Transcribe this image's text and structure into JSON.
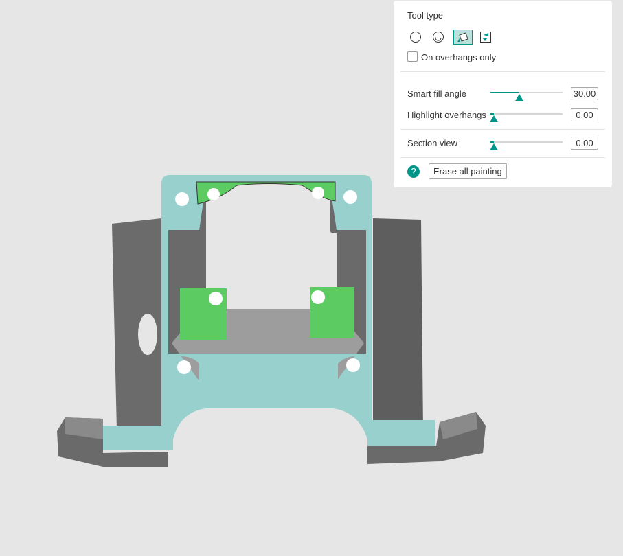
{
  "panel": {
    "tool_type_label": "Tool type",
    "tools": [
      {
        "name": "circle",
        "selected": false
      },
      {
        "name": "sphere",
        "selected": false
      },
      {
        "name": "fill",
        "selected": true
      },
      {
        "name": "gap-fill",
        "selected": false
      }
    ],
    "overhangs_only_label": "On overhangs only",
    "overhangs_only_checked": false,
    "smart_fill": {
      "label": "Smart fill angle",
      "value": "30.00",
      "fraction": 0.35
    },
    "highlight": {
      "label": "Highlight overhangs",
      "value": "0.00",
      "fraction": 0
    },
    "section": {
      "label": "Section view",
      "value": "0.00",
      "fraction": 0
    },
    "help_icon": "?",
    "erase_label": "Erase all painting"
  },
  "colors": {
    "accent": "#009688",
    "frame": "#97d0cc",
    "painted": "#5ccc62"
  }
}
